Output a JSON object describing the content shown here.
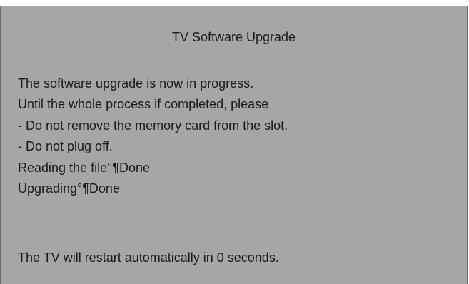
{
  "dialog": {
    "title": "TV Software Upgrade",
    "lines": [
      "The software upgrade is now in progress.",
      "Until the whole process if completed, please",
      "- Do not remove the memory card from the slot.",
      "- Do not plug off.",
      "Reading the file°¶Done",
      "Upgrading°¶Done"
    ],
    "footer": "The TV will restart automatically in 0 seconds."
  },
  "colors": {
    "dialog_background": "#a5a6a8",
    "text": "#1a1a1a",
    "border": "#6e6e6e"
  }
}
